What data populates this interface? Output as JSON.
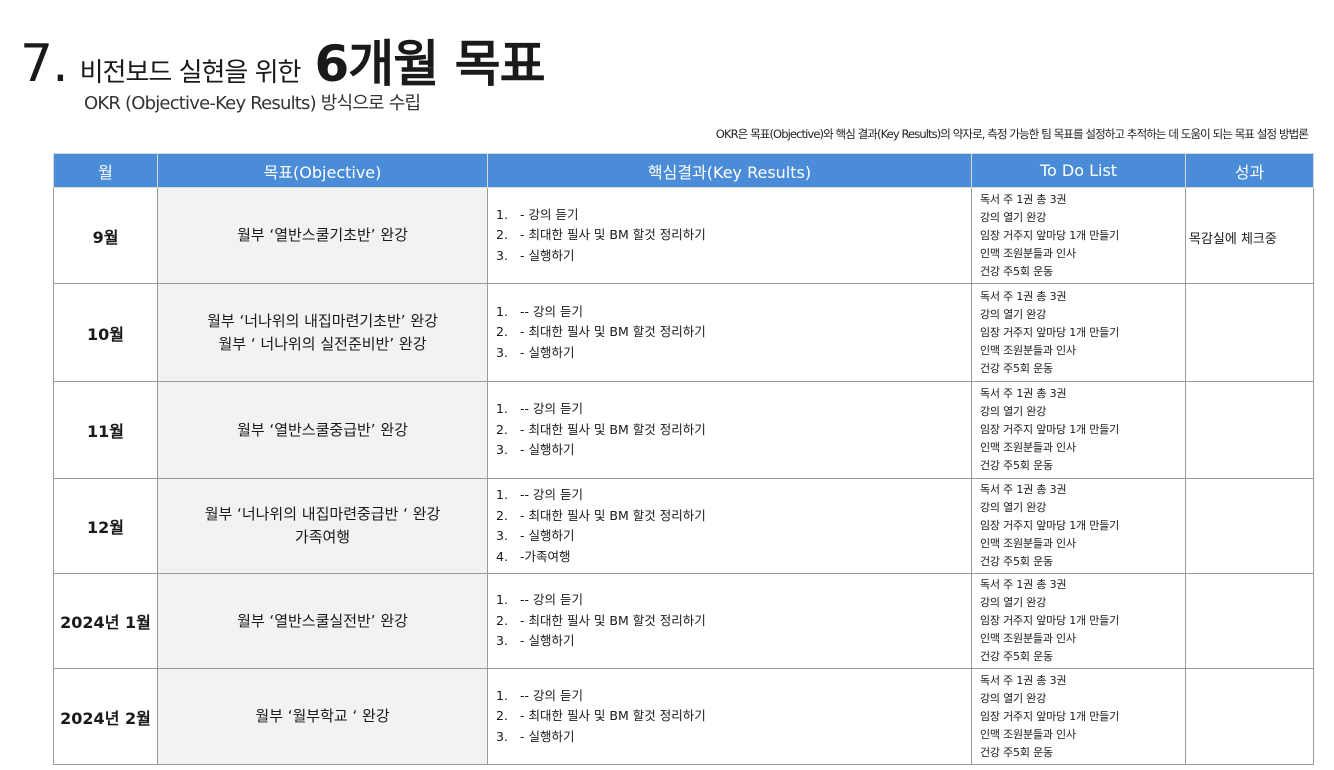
{
  "header": {
    "number": "7.",
    "subtitle_prefix": "비전보드 실현을 위한",
    "main_title": "6개월 목표",
    "subtitle": "OKR (Objective-Key Results) 방식으로 수립",
    "note": "OKR은 목표(Objective)와 핵심 결과(Key Results)의 약자로, 측정 가능한 팀 목표를 설정하고 추적하는 데 도움이 되는 목표 설정 방법론"
  },
  "table": {
    "columns": [
      "월",
      "목표(Objective)",
      "핵심결과(Key Results)",
      "To Do List",
      "성과"
    ],
    "rows": [
      {
        "month": "9월",
        "objective": [
          "월부 ‘열반스쿨기초반’ 완강"
        ],
        "key_results": [
          {
            "num": "1.",
            "text": "- 강의 듣기"
          },
          {
            "num": "2.",
            "text": "- 최대한 필사 및 BM 할것 정리하기"
          },
          {
            "num": "3.",
            "text": "- 실행하기"
          }
        ],
        "todo": [
          "독서 주 1권 총 3권",
          "강의 열기 완강",
          "임장 거주지 앞마당 1개 만들기",
          "인맥 조원분들과 인사",
          "건강 주5회 운동"
        ],
        "result": "목감실에 체크중"
      },
      {
        "month": "10월",
        "objective": [
          "월부 ‘너나위의 내집마련기초반’ 완강",
          "월부 ‘ 너나위의 실전준비반’ 완강"
        ],
        "key_results": [
          {
            "num": "1.",
            "text": "-- 강의 듣기"
          },
          {
            "num": "2.",
            "text": "- 최대한 필사 및 BM 할것 정리하기"
          },
          {
            "num": "3.",
            "text": "- 실행하기"
          }
        ],
        "todo": [
          "독서 주 1권 총 3권",
          "강의 열기 완강",
          "임장 거주지 앞마당 1개 만들기",
          "인맥 조원분들과 인사",
          "건강 주5회 운동"
        ],
        "result": ""
      },
      {
        "month": "11월",
        "objective": [
          "월부 ‘열반스쿨중급반’ 완강"
        ],
        "key_results": [
          {
            "num": "1.",
            "text": "-- 강의 듣기"
          },
          {
            "num": "2.",
            "text": "- 최대한 필사 및 BM 할것 정리하기"
          },
          {
            "num": "3.",
            "text": "- 실행하기"
          }
        ],
        "todo": [
          "독서 주 1권 총 3권",
          "강의 열기 완강",
          "임장 거주지 앞마당 1개 만들기",
          "인맥 조원분들과 인사",
          "건강 주5회 운동"
        ],
        "result": ""
      },
      {
        "month": "12월",
        "objective": [
          "월부 ‘너나위의 내집마련중급반 ‘ 완강",
          "가족여행"
        ],
        "key_results": [
          {
            "num": "1.",
            "text": "-- 강의 듣기"
          },
          {
            "num": "2.",
            "text": "- 최대한 필사 및 BM 할것 정리하기"
          },
          {
            "num": "3.",
            "text": "- 실행하기"
          },
          {
            "num": "4.",
            "text": "-가족여행"
          }
        ],
        "todo": [
          "독서 주 1권 총 3권",
          "강의 열기 완강",
          "임장 거주지 앞마당 1개 만들기",
          "인맥 조원분들과 인사",
          "건강 주5회 운동"
        ],
        "result": ""
      },
      {
        "month": "2024년 1월",
        "objective": [
          "월부 ‘열반스쿨실전반’ 완강"
        ],
        "key_results": [
          {
            "num": "1.",
            "text": "-- 강의 듣기"
          },
          {
            "num": "2.",
            "text": "- 최대한 필사 및 BM 할것 정리하기"
          },
          {
            "num": "3.",
            "text": "- 실행하기"
          }
        ],
        "todo": [
          "독서 주 1권 총 3권",
          "강의 열기 완강",
          "임장 거주지 앞마당 1개 만들기",
          "인맥 조원분들과 인사",
          "건강 주5회 운동"
        ],
        "result": ""
      },
      {
        "month": "2024년 2월",
        "objective": [
          "월부 ‘월부학교 ‘ 완강"
        ],
        "key_results": [
          {
            "num": "1.",
            "text": "-- 강의 듣기"
          },
          {
            "num": "2.",
            "text": "- 최대한 필사 및 BM 할것 정리하기"
          },
          {
            "num": "3.",
            "text": "- 실행하기"
          }
        ],
        "todo": [
          "독서 주 1권 총 3권",
          "강의 열기 완강",
          "임장 거주지 앞마당 1개 만들기",
          "인맥 조원분들과 인사",
          "건강 주5회 운동"
        ],
        "result": ""
      }
    ]
  }
}
